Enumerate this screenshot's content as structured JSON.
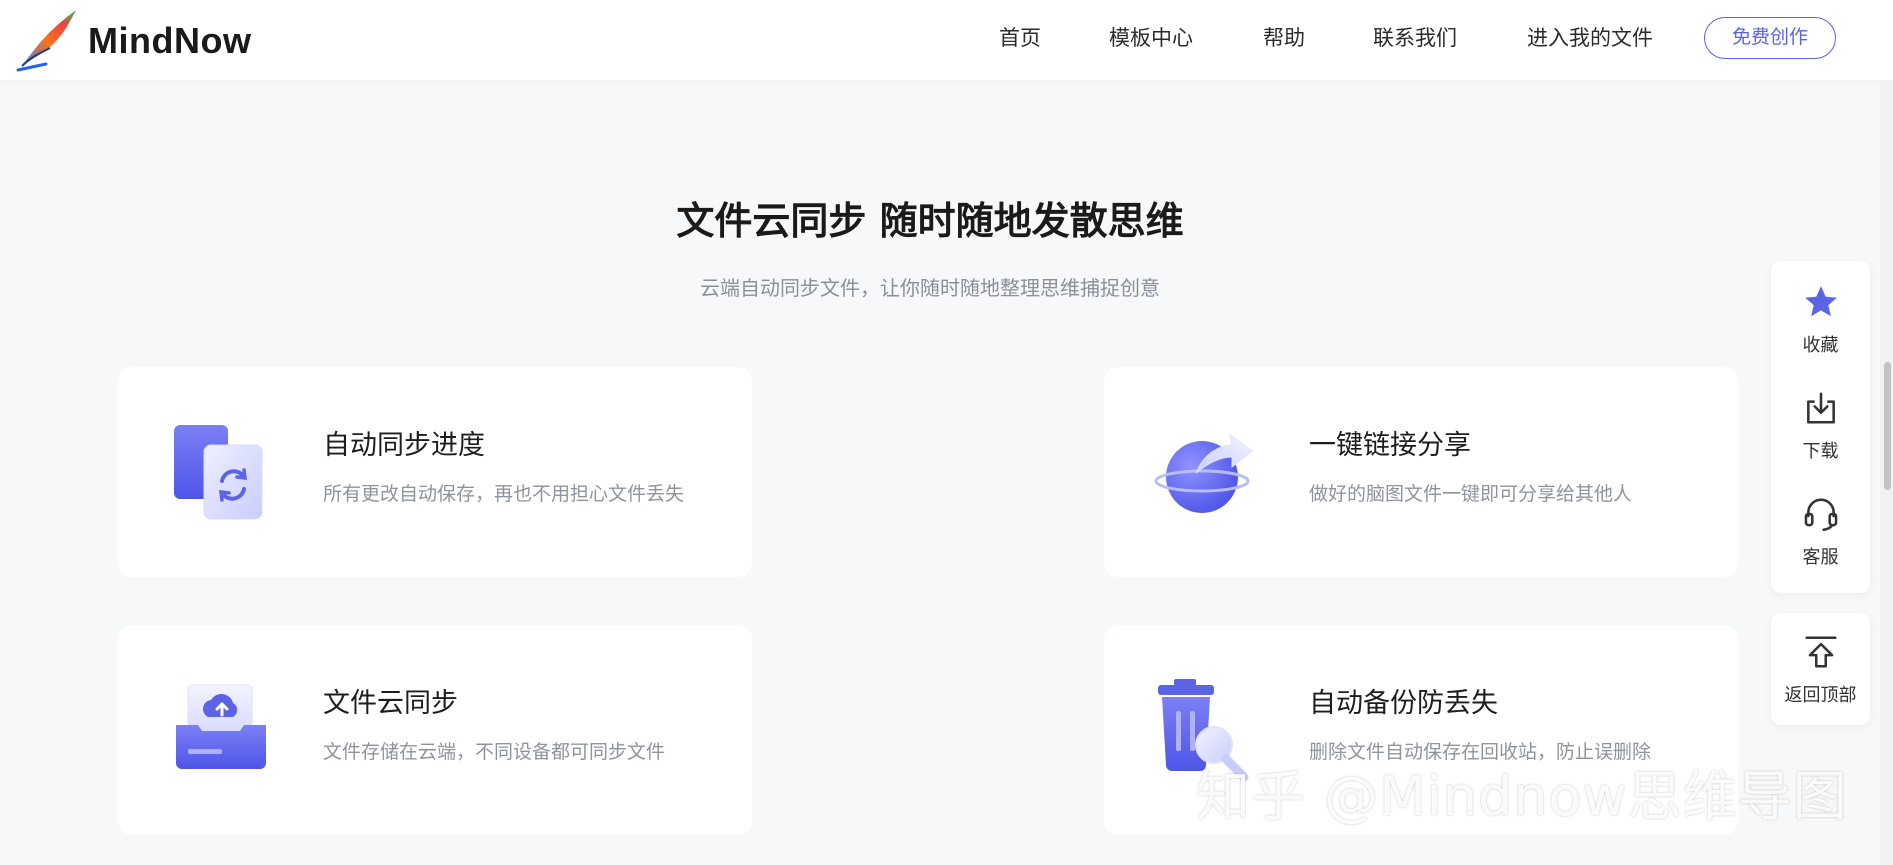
{
  "header": {
    "brand": "MindNow",
    "nav": [
      "首页",
      "模板中心",
      "帮助",
      "联系我们",
      "进入我的文件"
    ],
    "cta": "免费创作"
  },
  "section": {
    "title": "文件云同步 随时随地发散思维",
    "subtitle": "云端自动同步文件，让你随时随地整理思维捕捉创意"
  },
  "features": [
    {
      "title": "自动同步进度",
      "desc": "所有更改自动保存，再也不用担心文件丢失",
      "icon": "sync-files-icon"
    },
    {
      "title": "一键链接分享",
      "desc": "做好的脑图文件一键即可分享给其他人",
      "icon": "share-globe-icon"
    },
    {
      "title": "文件云同步",
      "desc": "文件存储在云端，不同设备都可同步文件",
      "icon": "cloud-upload-icon"
    },
    {
      "title": "自动备份防丢失",
      "desc": "删除文件自动保存在回收站，防止误删除",
      "icon": "trash-search-icon"
    }
  ],
  "side_panel": {
    "items": [
      {
        "label": "收藏",
        "icon": "star-icon"
      },
      {
        "label": "下载",
        "icon": "download-icon"
      },
      {
        "label": "客服",
        "icon": "headset-icon"
      }
    ],
    "back_top": {
      "label": "返回顶部",
      "icon": "back-to-top-icon"
    }
  },
  "watermark": "知乎 @Mindnow思维导图",
  "colors": {
    "accent": "#5b63e6",
    "background": "#f7f8fa",
    "card": "#ffffff"
  }
}
